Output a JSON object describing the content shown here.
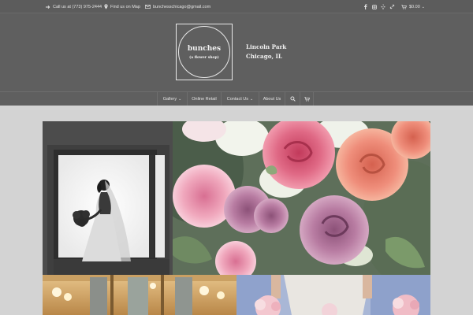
{
  "topbar": {
    "phone": "Call us at (773) 975-2444",
    "map": "Find us on Map",
    "email": "bunchesschicago@gmail.com",
    "social_icons": [
      "facebook-icon",
      "instagram-icon",
      "yelp-icon",
      "link-icon"
    ],
    "cart_total": "$0.00"
  },
  "logo": {
    "name": "bunches",
    "tagline": "(a flower shop)"
  },
  "location": {
    "line1": "Lincoln Park",
    "line2": "Chicago, IL"
  },
  "nav": {
    "items": [
      {
        "label": "Gallery",
        "has_dropdown": true
      },
      {
        "label": "Online Retail",
        "has_dropdown": false
      },
      {
        "label": "Contact Us",
        "has_dropdown": true
      },
      {
        "label": "About Us",
        "has_dropdown": false
      }
    ],
    "search_icon": "search-icon",
    "cart_icon": "cart-icon"
  },
  "gallery": {
    "photos": [
      {
        "name": "bride-silhouette-photo"
      },
      {
        "name": "rose-bouquet-photo"
      },
      {
        "name": "chandelier-interior-photo"
      },
      {
        "name": "bridesmaids-bouquets-photo"
      }
    ]
  },
  "colors": {
    "header_bg": "#5f5f5f",
    "topbar_bg": "#5c5c5c",
    "page_bg": "#d3d3d3",
    "text_light": "#e4e4e4"
  }
}
